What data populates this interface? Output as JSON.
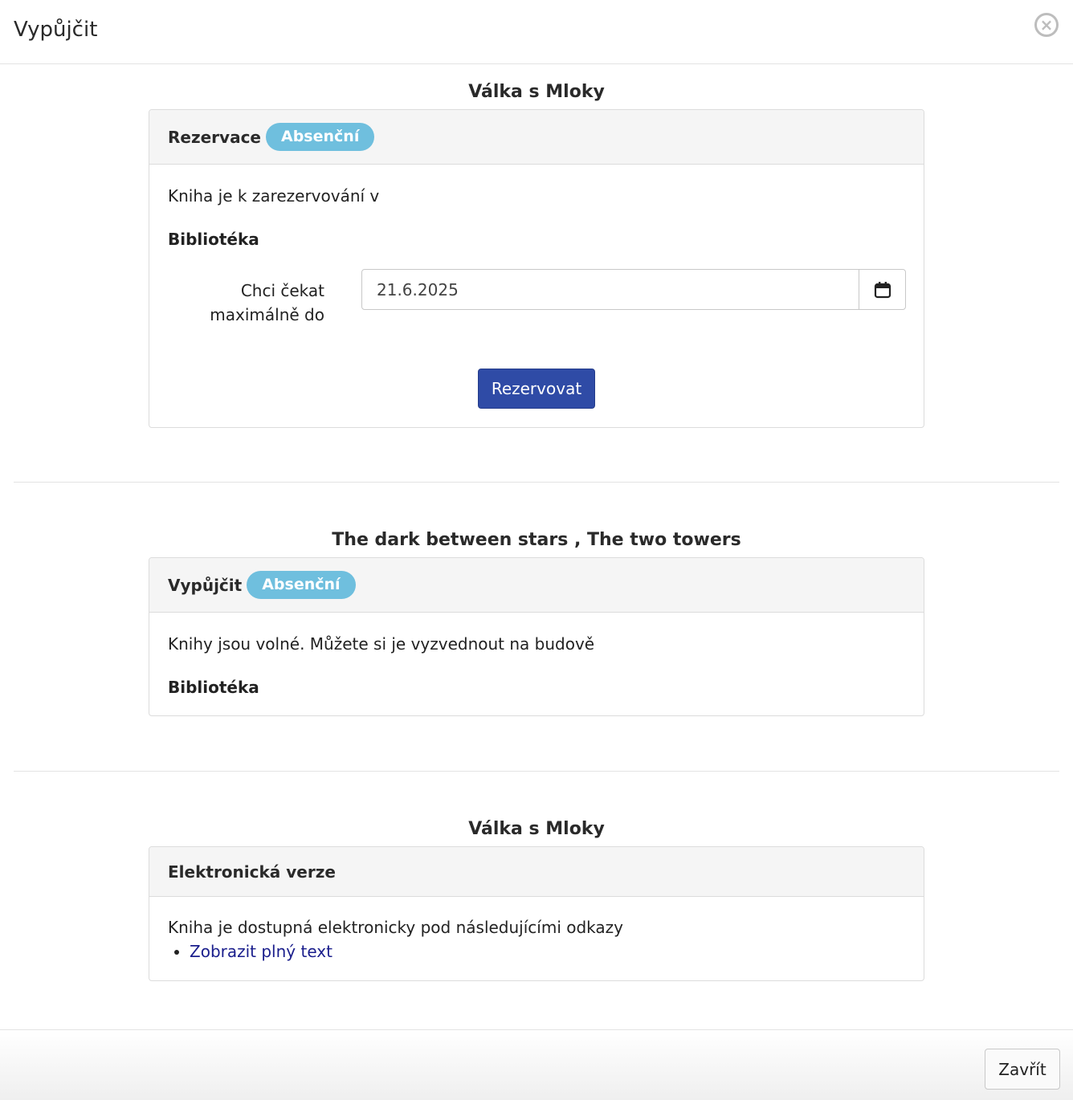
{
  "modal": {
    "title": "Vypůjčit",
    "close_icon": "×"
  },
  "sections": [
    {
      "title": "Válka s Mloky",
      "card_title": "Rezervace",
      "badge": "Absenční",
      "text": "Kniha je k zarezervování v",
      "library": "Bibliotéka",
      "date_label": "Chci čekat maximálně do",
      "date_value": "21.6.2025",
      "button": "Rezervovat"
    },
    {
      "title": "The dark between stars , The two towers",
      "card_title": "Vypůjčit",
      "badge": "Absenční",
      "text": "Knihy jsou volné. Můžete si je vyzvednout na budově",
      "library": "Bibliotéka"
    },
    {
      "title": "Válka s Mloky",
      "card_title": "Elektronická verze",
      "text": "Kniha je dostupná elektronicky pod následujícími odkazy",
      "links": [
        "Zobrazit plný text"
      ]
    }
  ],
  "footer": {
    "close_button": "Zavřít"
  },
  "icons": {
    "calendar": "calendar-icon",
    "close": "close-circle-icon"
  },
  "colors": {
    "primary": "#2f4ba6",
    "badge": "#6fbfde",
    "link": "#1a1e8c"
  }
}
